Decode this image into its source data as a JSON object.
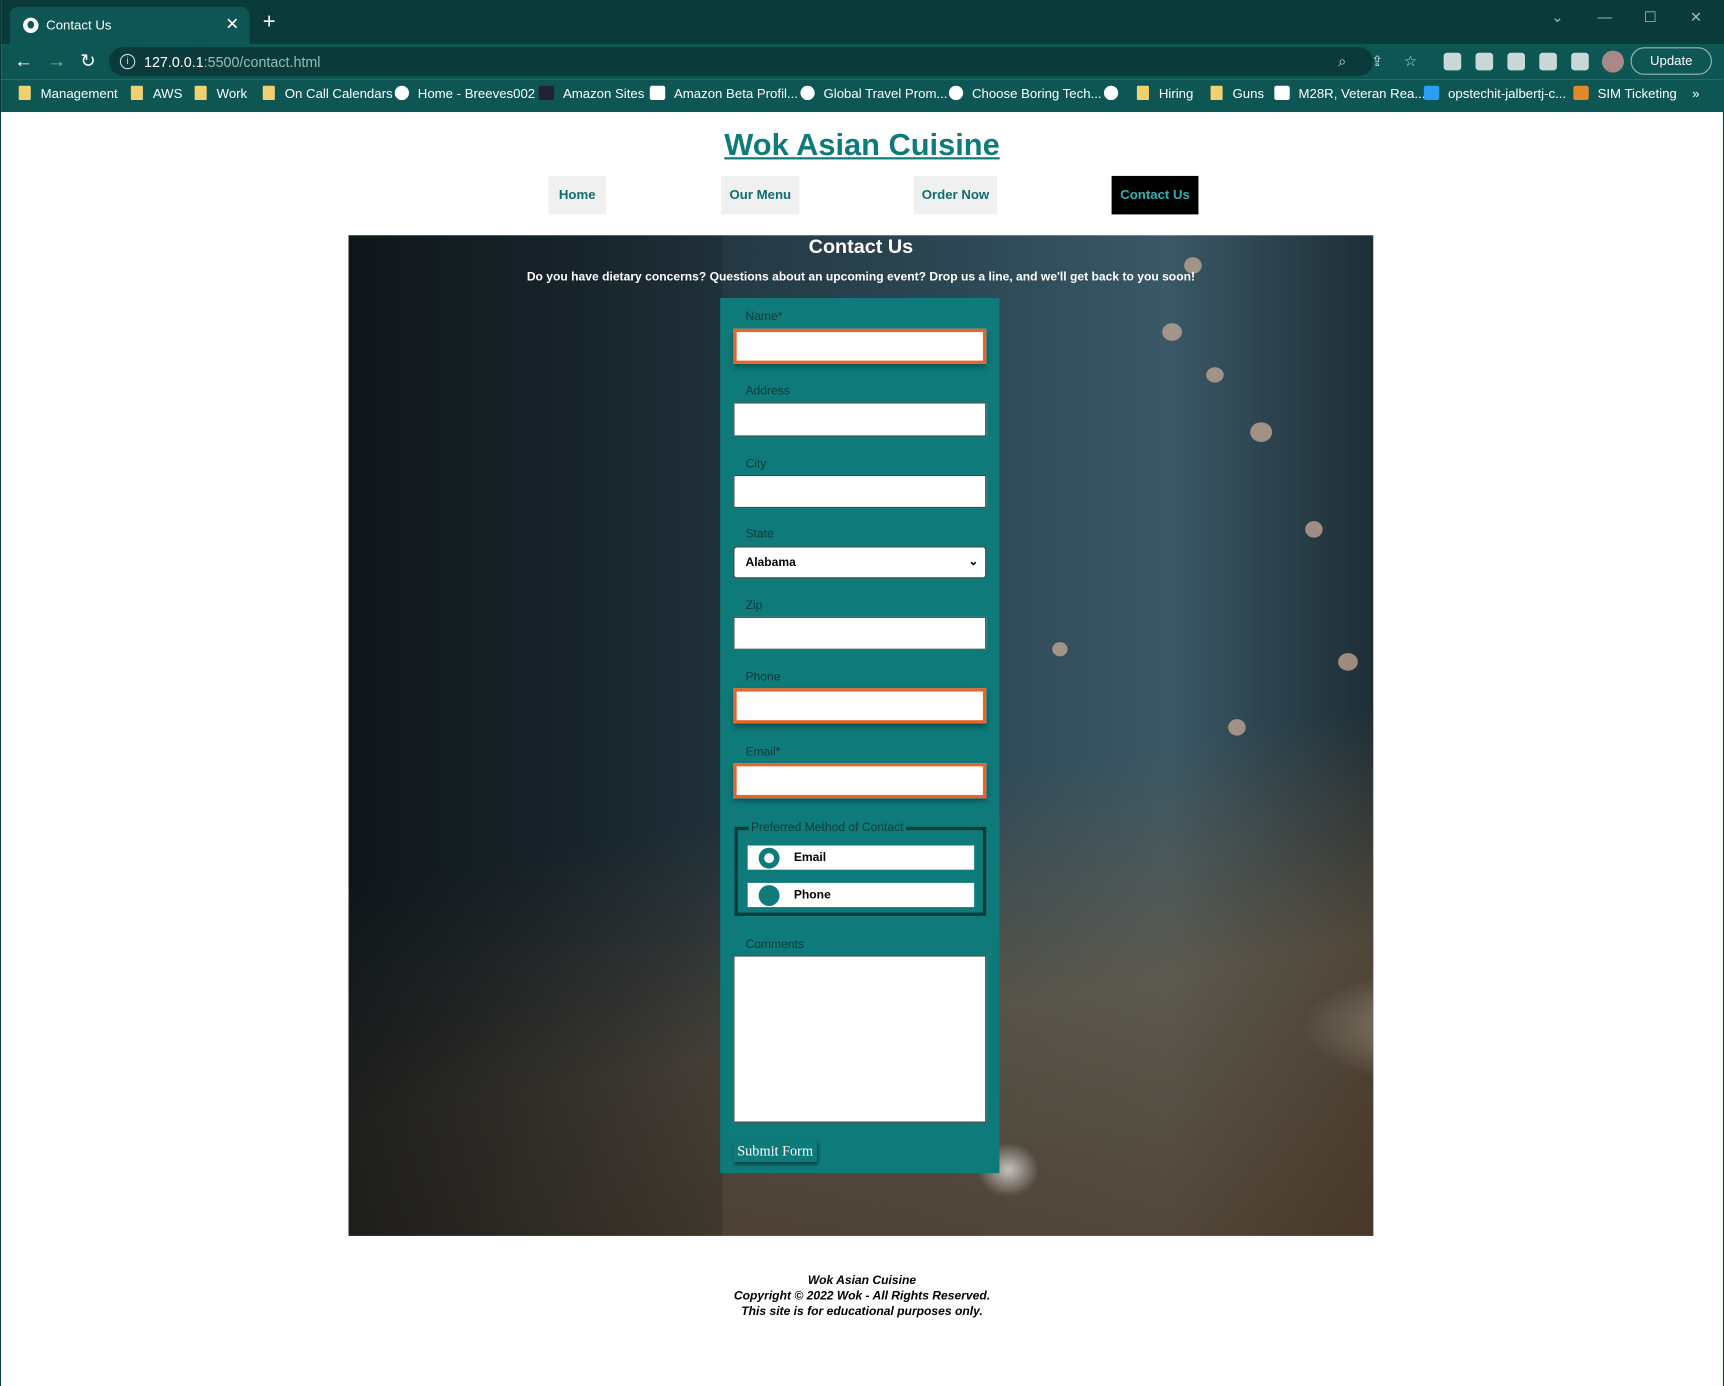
{
  "browser": {
    "tab_title": "Contact Us",
    "url_host": "127.0.0.1",
    "url_rest": ":5500/contact.html",
    "update_label": "Update"
  },
  "bookmarks": [
    {
      "label": "Management",
      "icon": "folder-icon"
    },
    {
      "label": "AWS",
      "icon": "folder-icon"
    },
    {
      "label": "Work",
      "icon": "folder-icon"
    },
    {
      "label": "On Call Calendars",
      "icon": "folder-icon"
    },
    {
      "label": "Home - Breeves002",
      "icon": "globe-icon"
    },
    {
      "label": "Amazon Sites",
      "icon": "amazon-icon"
    },
    {
      "label": "Amazon Beta Profil...",
      "icon": "amazon-a-icon"
    },
    {
      "label": "Global Travel Prom...",
      "icon": "globe-icon"
    },
    {
      "label": "Choose Boring Tech...",
      "icon": "globe-icon"
    },
    {
      "label": "",
      "icon": "globe-icon"
    },
    {
      "label": "Hiring",
      "icon": "folder-icon"
    },
    {
      "label": "Guns",
      "icon": "folder-icon"
    },
    {
      "label": "M28R, Veteran Rea...",
      "icon": "va-icon"
    },
    {
      "label": "opstechit-jalbertj-c...",
      "icon": "chart-icon"
    },
    {
      "label": "SIM Ticketing",
      "icon": "t-icon"
    }
  ],
  "site": {
    "title": "Wok Asian Cuisine"
  },
  "nav": {
    "home": "Home",
    "menu": "Our Menu",
    "order": "Order Now",
    "contact": "Contact Us"
  },
  "hero": {
    "title": "Contact Us",
    "subtitle": "Do you have dietary concerns? Questions about an upcoming event? Drop us a line, and we'll get back to you soon!"
  },
  "form": {
    "name_label": "Name*",
    "address_label": "Address",
    "city_label": "City",
    "state_label": "State",
    "state_value": "Alabama",
    "zip_label": "Zip",
    "phone_label": "Phone",
    "email_label": "Email*",
    "contact_legend": "Preferred Method of Contact",
    "option_email": "Email",
    "option_phone": "Phone",
    "comments_label": "Comments",
    "submit_label": "Submit Form"
  },
  "footer": {
    "line1": "Wok Asian Cuisine",
    "line2": "Copyright © 2022 Wok - All Rights Reserved.",
    "line3": "This site is for educational purposes only."
  },
  "colors": {
    "teal": "#0e7a7a",
    "required_border": "#e8652a",
    "active_nav": "#000000"
  }
}
